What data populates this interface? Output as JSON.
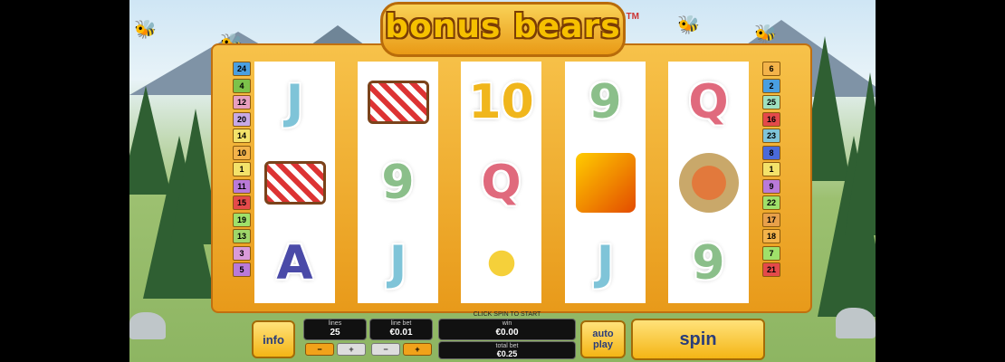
{
  "game": {
    "logo_text": "bonus bears",
    "trademark": "TM"
  },
  "reels": [
    [
      "J",
      "picnic-basket",
      "A"
    ],
    [
      "picnic-basket",
      "9",
      "J"
    ],
    [
      "10",
      "Q",
      "bee"
    ],
    [
      "9",
      "bear",
      "J"
    ],
    [
      "Q",
      "ranger",
      "9"
    ]
  ],
  "paylines_left": [
    "24",
    "4",
    "12",
    "20",
    "14",
    "10",
    "1",
    "11",
    "15",
    "19",
    "13",
    "3",
    "5"
  ],
  "paylines_right": [
    "6",
    "2",
    "25",
    "16",
    "23",
    "8",
    "1",
    "9",
    "22",
    "17",
    "18",
    "7",
    "21"
  ],
  "paylines_left_colors": [
    "#4a9fe0",
    "#7cc24a",
    "#e89fc0",
    "#c7a9e6",
    "#f3e26a",
    "#f3b34a",
    "#f3e26a",
    "#b97ad9",
    "#e44a4a",
    "#9fe06a",
    "#9fd66a",
    "#d99ad9",
    "#b97ad9"
  ],
  "paylines_right_colors": [
    "#f3b34a",
    "#4a9fe0",
    "#9fe0c0",
    "#e44a4a",
    "#7fc4d8",
    "#4a6ad9",
    "#f3e26a",
    "#b97ad9",
    "#9fe06a",
    "#e8a04a",
    "#f3b34a",
    "#9fe06a",
    "#e44a4a"
  ],
  "controls": {
    "info_label": "info",
    "hint": "CLICK SPIN TO START",
    "lines_label": "lines",
    "lines_value": "25",
    "line_bet_label": "line bet",
    "line_bet_value": "€0.01",
    "win_label": "win",
    "win_value": "€0.00",
    "total_bet_label": "total bet",
    "total_bet_value": "€0.25",
    "minus": "−",
    "plus": "+",
    "autoplay_label": "auto play",
    "spin_label": "spin"
  }
}
